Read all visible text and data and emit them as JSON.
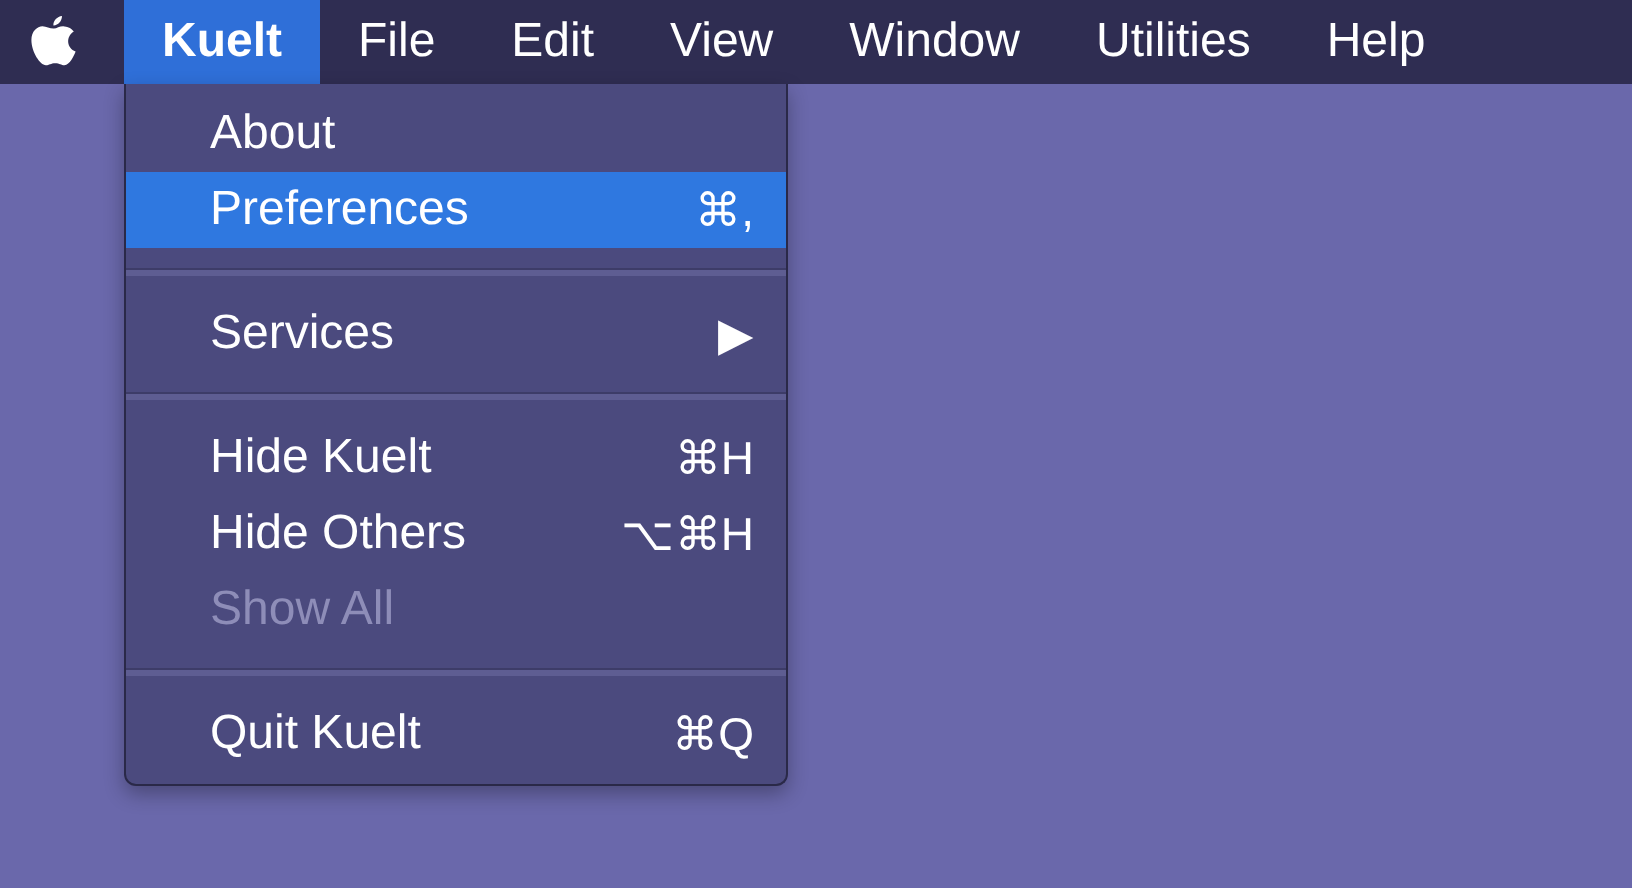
{
  "menu_bar": {
    "items": [
      {
        "label": "Kuelt",
        "selected": true,
        "bold": true
      },
      {
        "label": "File",
        "selected": false,
        "bold": false
      },
      {
        "label": "Edit",
        "selected": false,
        "bold": false
      },
      {
        "label": "View",
        "selected": false,
        "bold": false
      },
      {
        "label": "Window",
        "selected": false,
        "bold": false
      },
      {
        "label": "Utilities",
        "selected": false,
        "bold": false
      },
      {
        "label": "Help",
        "selected": false,
        "bold": false
      }
    ]
  },
  "menu": {
    "items": [
      {
        "kind": "item",
        "label": "About",
        "selected": false,
        "disabled": false
      },
      {
        "kind": "item",
        "label": "Preferences",
        "shortcut": "⌘,",
        "selected": true,
        "disabled": false
      },
      {
        "kind": "separator"
      },
      {
        "kind": "item",
        "label": "Services",
        "shortcut": "▶",
        "selected": false,
        "disabled": false
      },
      {
        "kind": "separator"
      },
      {
        "kind": "item",
        "label": "Hide Kuelt",
        "shortcut": "⌘H",
        "selected": false,
        "disabled": false
      },
      {
        "kind": "item",
        "label": "Hide Others",
        "shortcut": "⌥⌘H",
        "selected": false,
        "disabled": false
      },
      {
        "kind": "item",
        "label": "Show All",
        "selected": false,
        "disabled": true
      },
      {
        "kind": "separator"
      },
      {
        "kind": "item",
        "label": "Quit Kuelt",
        "shortcut": "⌘Q",
        "selected": false,
        "disabled": false
      }
    ]
  }
}
